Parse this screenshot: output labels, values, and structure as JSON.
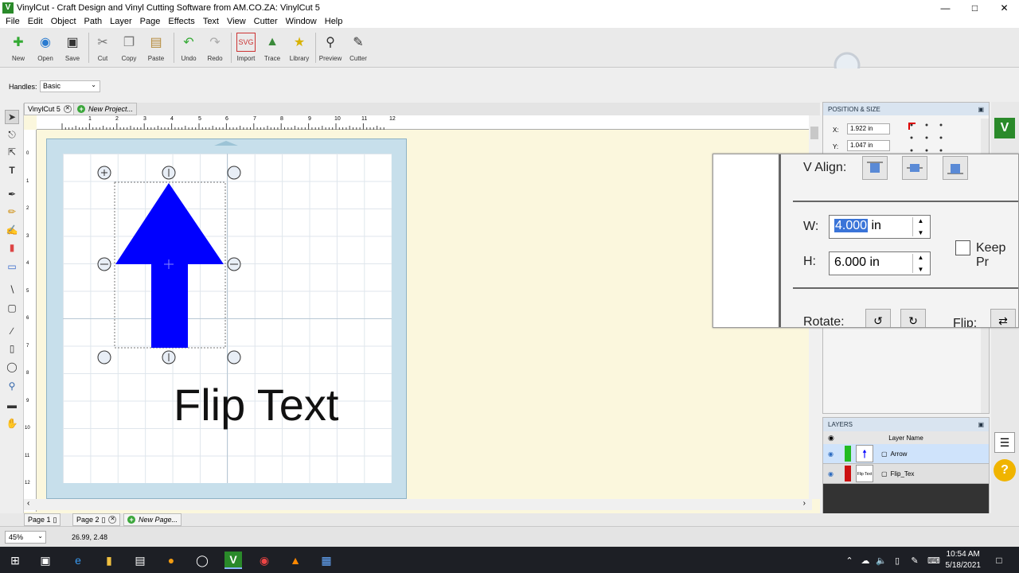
{
  "window": {
    "title": "VinylCut - Craft Design and Vinyl Cutting Software from AM.CO.ZA: VinylCut 5",
    "icon_letter": "V"
  },
  "menu": [
    "File",
    "Edit",
    "Object",
    "Path",
    "Layer",
    "Page",
    "Effects",
    "Text",
    "View",
    "Cutter",
    "Window",
    "Help"
  ],
  "toolbar": [
    {
      "label": "New",
      "icon": "new-file-icon"
    },
    {
      "label": "Open",
      "icon": "open-icon"
    },
    {
      "label": "Save",
      "icon": "save-icon"
    },
    {
      "label": "Cut",
      "icon": "cut-icon"
    },
    {
      "label": "Copy",
      "icon": "copy-icon"
    },
    {
      "label": "Paste",
      "icon": "paste-icon"
    },
    {
      "label": "Undo",
      "icon": "undo-icon"
    },
    {
      "label": "Redo",
      "icon": "redo-icon"
    },
    {
      "label": "Import",
      "icon": "import-svg-icon"
    },
    {
      "label": "Trace",
      "icon": "trace-icon"
    },
    {
      "label": "Library",
      "icon": "library-icon"
    },
    {
      "label": "Preview",
      "icon": "preview-icon"
    },
    {
      "label": "Cutter",
      "icon": "cutter-icon"
    }
  ],
  "handles": {
    "label": "Handles:",
    "value": "Basic"
  },
  "doc_tabs": {
    "current": "VinylCut 5",
    "new": "New Project..."
  },
  "ruler": {
    "h_ticks": [
      "1",
      "2",
      "3",
      "4",
      "5",
      "6",
      "7",
      "8",
      "9",
      "10",
      "11",
      "12"
    ],
    "v_ticks": [
      "0",
      "1",
      "2",
      "3",
      "4",
      "5",
      "6",
      "7",
      "8",
      "9",
      "10",
      "11",
      "12"
    ]
  },
  "canvas_text": "Flip Text",
  "position_panel": {
    "title": "POSITION & SIZE",
    "x_label": "X:",
    "x_value": "1.922 in",
    "y_label": "Y:",
    "y_value": "1.047 in"
  },
  "popup": {
    "valign_label": "V Align:",
    "w_label": "W:",
    "w_value": "4.000",
    "w_unit": " in",
    "h_label": "H:",
    "h_value": "6.000 in",
    "keep_label": "Keep Pr",
    "rotate_label": "Rotate:",
    "flip_label": "Flip:"
  },
  "layers": {
    "title": "LAYERS",
    "column": "Layer Name",
    "rows": [
      {
        "name": "Arrow",
        "color": "#22bb22",
        "thumb": "arrow"
      },
      {
        "name": "Flip_Tex",
        "color": "#cc1111",
        "thumb": "Flip Text"
      }
    ]
  },
  "pages": {
    "page1": "Page 1",
    "page2": "Page 2",
    "new": "New Page..."
  },
  "status": {
    "zoom": "45%",
    "coords": "26.99, 2.48"
  },
  "clock": {
    "time": "10:54 AM",
    "date": "5/18/2021"
  }
}
